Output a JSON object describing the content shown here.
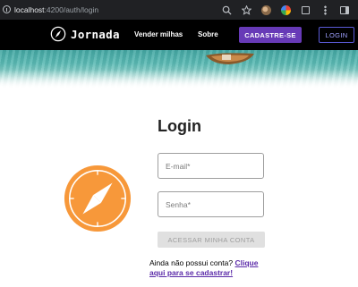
{
  "browser": {
    "url_host": "localhost",
    "url_path": ":4200/auth/login",
    "icons": [
      "info-icon",
      "zoom-icon",
      "bookmark-star-icon",
      "profile-extension-icon",
      "color-extension-icon",
      "extensions-puzzle-icon",
      "menu-dots-icon",
      "side-panel-icon"
    ]
  },
  "navbar": {
    "brand": "Jornada",
    "links": [
      "Vender milhas",
      "Sobre"
    ],
    "signup_label": "CADASTRE-SE",
    "login_label": "LOGIN",
    "colors": {
      "background": "#000000",
      "signup": "#673ab7",
      "login_border": "#5a5ad6"
    }
  },
  "login": {
    "title": "Login",
    "email_placeholder": "E-mail*",
    "password_placeholder": "Senha*",
    "submit_label": "ACESSAR MINHA CONTA",
    "signup_prompt": "Ainda não possui conta?",
    "signup_link": "Clique aqui para se cadastrar!"
  },
  "illustration": {
    "icon": "compass-icon",
    "color": "#f7983a"
  }
}
